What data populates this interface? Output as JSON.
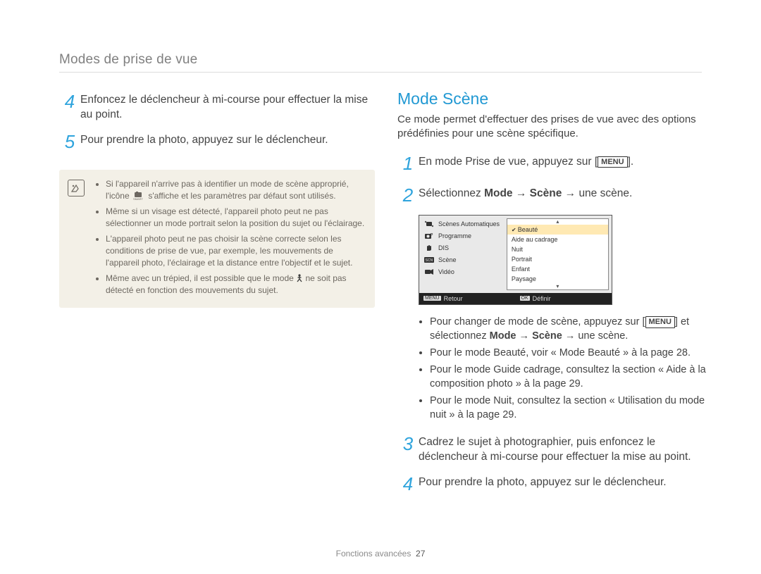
{
  "header": {
    "breadcrumb": "Modes de prise de vue"
  },
  "left": {
    "steps": [
      {
        "num": "4",
        "text": "Enfoncez le déclencheur à mi-course pour effectuer la mise au point."
      },
      {
        "num": "5",
        "text": "Pour prendre la photo, appuyez sur le déclencheur."
      }
    ],
    "note": {
      "icon_name": "note-badge-icon",
      "items": [
        {
          "pre": "Si l'appareil n'arrive pas à identifier un mode de scène approprié, l'icône ",
          "icon": "smart-scene-icon",
          "post": " s'affiche et les paramètres par défaut sont utilisés."
        },
        {
          "pre": "Même si un visage est détecté, l'appareil photo peut ne pas sélectionner un mode portrait selon la position du sujet ou l'éclairage."
        },
        {
          "pre": "L'appareil photo peut ne pas choisir la scène correcte selon les conditions de prise de vue, par exemple, les mouvements de l'appareil photo, l'éclairage et la distance entre l'objectif et le sujet."
        },
        {
          "pre": "Même avec un trépied, il est possible que le mode ",
          "icon": "tripod-person-icon",
          "post": " ne soit pas détecté en fonction des mouvements du sujet."
        }
      ]
    }
  },
  "right": {
    "heading": "Mode Scène",
    "intro": "Ce mode permet d'effectuer des prises de vue avec des options prédéfinies pour une scène spécifique.",
    "step1": {
      "num": "1",
      "prefix": "En mode Prise de vue, appuyez sur [",
      "menu": "MENU",
      "suffix": "]."
    },
    "step2": {
      "num": "2",
      "prefix": "Sélectionnez ",
      "b1": "Mode",
      "arrow": " → ",
      "b2": "Scène",
      "suffix": " → une scène."
    },
    "screen": {
      "left_modes": [
        {
          "icon": "sparkle-icon",
          "label": "Scènes Automatiques"
        },
        {
          "icon": "camera-p-icon",
          "label": "Programme"
        },
        {
          "icon": "hand-icon",
          "label": "DIS"
        },
        {
          "icon": "scene-badge-icon",
          "label": "Scène"
        },
        {
          "icon": "video-cam-icon",
          "label": "Vidéo"
        }
      ],
      "right_options": [
        "Beauté",
        "Aide au cadrage",
        "Nuit",
        "Portrait",
        "Enfant",
        "Paysage"
      ],
      "selected": "Beauté",
      "bar": {
        "back_key": "MENU",
        "back_label": "Retour",
        "ok_key": "OK",
        "ok_label": "Définir"
      }
    },
    "sub_bullets": [
      {
        "pre": "Pour changer de mode de scène, appuyez sur [",
        "menu": "MENU",
        "mid": "] et sélectionnez ",
        "b1": "Mode",
        "arrow": " → ",
        "b2": "Scène",
        "suffix": " → une scène."
      },
      {
        "pre": "Pour le mode Beauté, voir « Mode Beauté » à la page 28."
      },
      {
        "pre": "Pour le mode Guide cadrage, consultez la section « Aide à la composition photo » à la page 29."
      },
      {
        "pre": "Pour le mode Nuit, consultez la section « Utilisation du mode nuit » à la page 29."
      }
    ],
    "step3": {
      "num": "3",
      "text": "Cadrez le sujet à photographier, puis enfoncez le déclencheur à mi-course pour effectuer la mise au point."
    },
    "step4": {
      "num": "4",
      "text": "Pour prendre la photo, appuyez sur le déclencheur."
    }
  },
  "footer": {
    "section": "Fonctions avancées",
    "page": "27"
  }
}
